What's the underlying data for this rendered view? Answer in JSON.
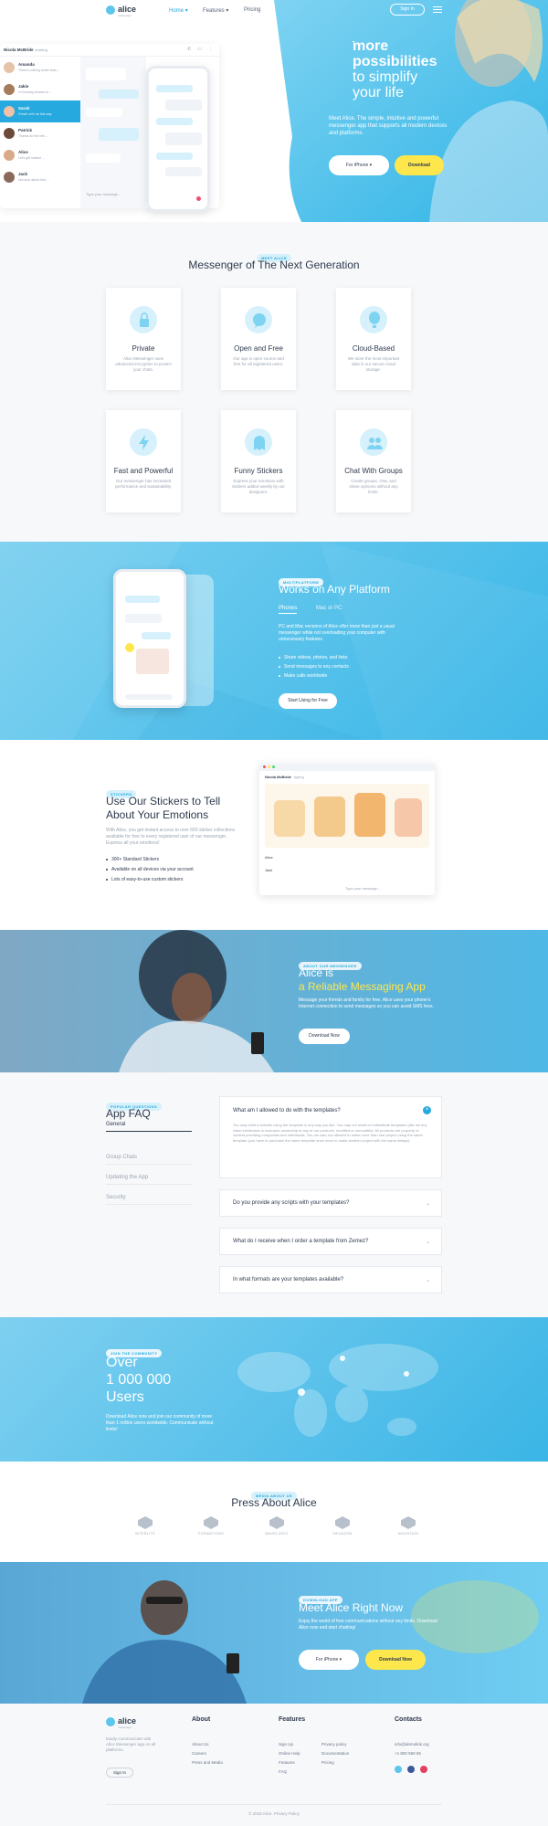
{
  "nav": {
    "logo": "alice",
    "logo_sub": "messenger",
    "home": "Home",
    "features": "Features",
    "pricing": "Pricing",
    "signin": "Sign In"
  },
  "hero": {
    "title_line1": "more",
    "title_line2": "possibilities",
    "title_line3": "to simplify",
    "title_line4": "your life",
    "text": "Meet Alice. The simple, intuitive and powerful messenger app that supports all modern devices and platforms.",
    "platform_btn": "For iPhone",
    "download_btn": "Download"
  },
  "chat_mock": {
    "header": "Nicola McBride",
    "header_status": "chatting",
    "contacts": [
      {
        "name": "Amanda",
        "msg": "There's nothing better than..."
      },
      {
        "name": "Jakie",
        "msg": "I'm looking forward to ..."
      },
      {
        "name": "Sarah",
        "msg": "Great! Let's do this way"
      },
      {
        "name": "Patrick",
        "msg": "Thanks for the info ..."
      },
      {
        "name": "Alice",
        "msg": "Let's get started ..."
      },
      {
        "name": "Jack",
        "msg": "Not sure about that ..."
      }
    ],
    "input_placeholder": "Type your message..."
  },
  "features": {
    "pill": "MEET ALICE",
    "title": "Messenger of The Next Generation",
    "cards": [
      {
        "title": "Private",
        "text": "Alice Messenger uses advanced encryption to protect your chats."
      },
      {
        "title": "Open and Free",
        "text": "Our app is open source and free for all registered users."
      },
      {
        "title": "Cloud-Based",
        "text": "We store the most important data in our secure cloud storage."
      },
      {
        "title": "Fast and Powerful",
        "text": "Our messenger has increased performance and sustainability."
      },
      {
        "title": "Funny Stickers",
        "text": "Express your emotions with stickers added weekly by our designers."
      },
      {
        "title": "Chat With Groups",
        "text": "Create groups, chat, and share opinions without any limits."
      }
    ]
  },
  "platform": {
    "pill": "MULTIPLATFORM",
    "title": "Works on Any Platform",
    "tab1": "Phones",
    "tab2": "Mac or PC",
    "text": "PC and Mac versions of Alice offer more than just a usual messenger while not overloading your computer with unnecessary features.",
    "bullets": [
      "Share videos, photos, and links",
      "Send messages to any contacts",
      "Make calls worldwide"
    ],
    "button": "Start Using for Free"
  },
  "stickers": {
    "pill": "STICKERS",
    "title_line1": "Use Our Stickers to Tell",
    "title_line2": "About Your Emotions",
    "text": "With Alice, you get instant access to over 600 sticker collections available for free to every registered user of our messenger. Express all your emotions!",
    "bullets": [
      "300+ Standard Stickers",
      "Available on all devices via your account",
      "Lots of easy-to-use custom stickers"
    ],
    "mock_header": "Nicola McBride",
    "mock_status": "typing",
    "mock_names": [
      "Alice",
      "Jack"
    ],
    "mock_placeholder": "Type your message..."
  },
  "reliable": {
    "pill": "ABOUT OUR MESSENGER",
    "title1": "Alice is",
    "title2": "a Reliable Messaging App",
    "text": "Message your friends and family for free. Alice uses your phone's Internet connection to send messages so you can avoid SMS fees.",
    "button": "Download Now"
  },
  "faq": {
    "pill": "POPULAR QUESTIONS",
    "title": "App FAQ",
    "tabs": [
      "General",
      "Group Chats",
      "Updating the App",
      "Security"
    ],
    "open_q": "What am I allowed to do with the templates?",
    "open_a": "You may build a website using the template in any way you like. You may not resell or redistribute templates (like we do); claim intellectual or exclusive ownership to any of our products, modified or unmodified. All products are property of content providing companies and individuals. You are also not allowed to make more than one project using the same template (you have to purchase the same template once more to make another project with the same design).",
    "questions": [
      "Do you provide any scripts with your templates?",
      "What do I receive when I order a template from Zemez?",
      "In what formats are your templates available?"
    ]
  },
  "users": {
    "pill": "JOIN THE COMMUNITY",
    "line1": "Over",
    "line2": "1 000 000",
    "line3": "Users",
    "text": "Download Alice now and join our community of more than 1 million users worldwide. Communicate without limits!"
  },
  "press": {
    "pill": "MEDIA ABOUT US",
    "title": "Press About Alice",
    "logos": [
      "INTERLITE",
      "FORMATIONS",
      "WAVELOGIC",
      "HEXAGON",
      "MOUNTAIN"
    ]
  },
  "cta": {
    "pill": "DOWNLOAD APP",
    "title": "Meet Alice Right Now",
    "text": "Enjoy the world of free communications without any limits. Download Alice now and start chatting!",
    "platform_btn": "For iPhone",
    "download_btn": "Download Now"
  },
  "footer": {
    "logo": "alice",
    "logo_sub": "messenger",
    "about_text": "Easily communicate with Alice Messenger app on all platforms.",
    "signin": "Sign In",
    "about_h": "About",
    "about_links": [
      "About Us",
      "Careers",
      "Press and Media"
    ],
    "features_h": "Features",
    "features_col1": [
      "Sign Up",
      "Online Help",
      "Features",
      "FAQ"
    ],
    "features_col2": [
      "Privacy policy",
      "Documentation",
      "Pricing"
    ],
    "contacts_h": "Contacts",
    "email": "info@demolink.org",
    "phone": "+1 800 559 65",
    "copyright": "© 2018 Alice. Privacy Policy"
  },
  "colors": {
    "accent": "#26a9de",
    "sky": "#5cc6ec",
    "yellow": "#fde74c",
    "dark": "#2e3a4d"
  }
}
